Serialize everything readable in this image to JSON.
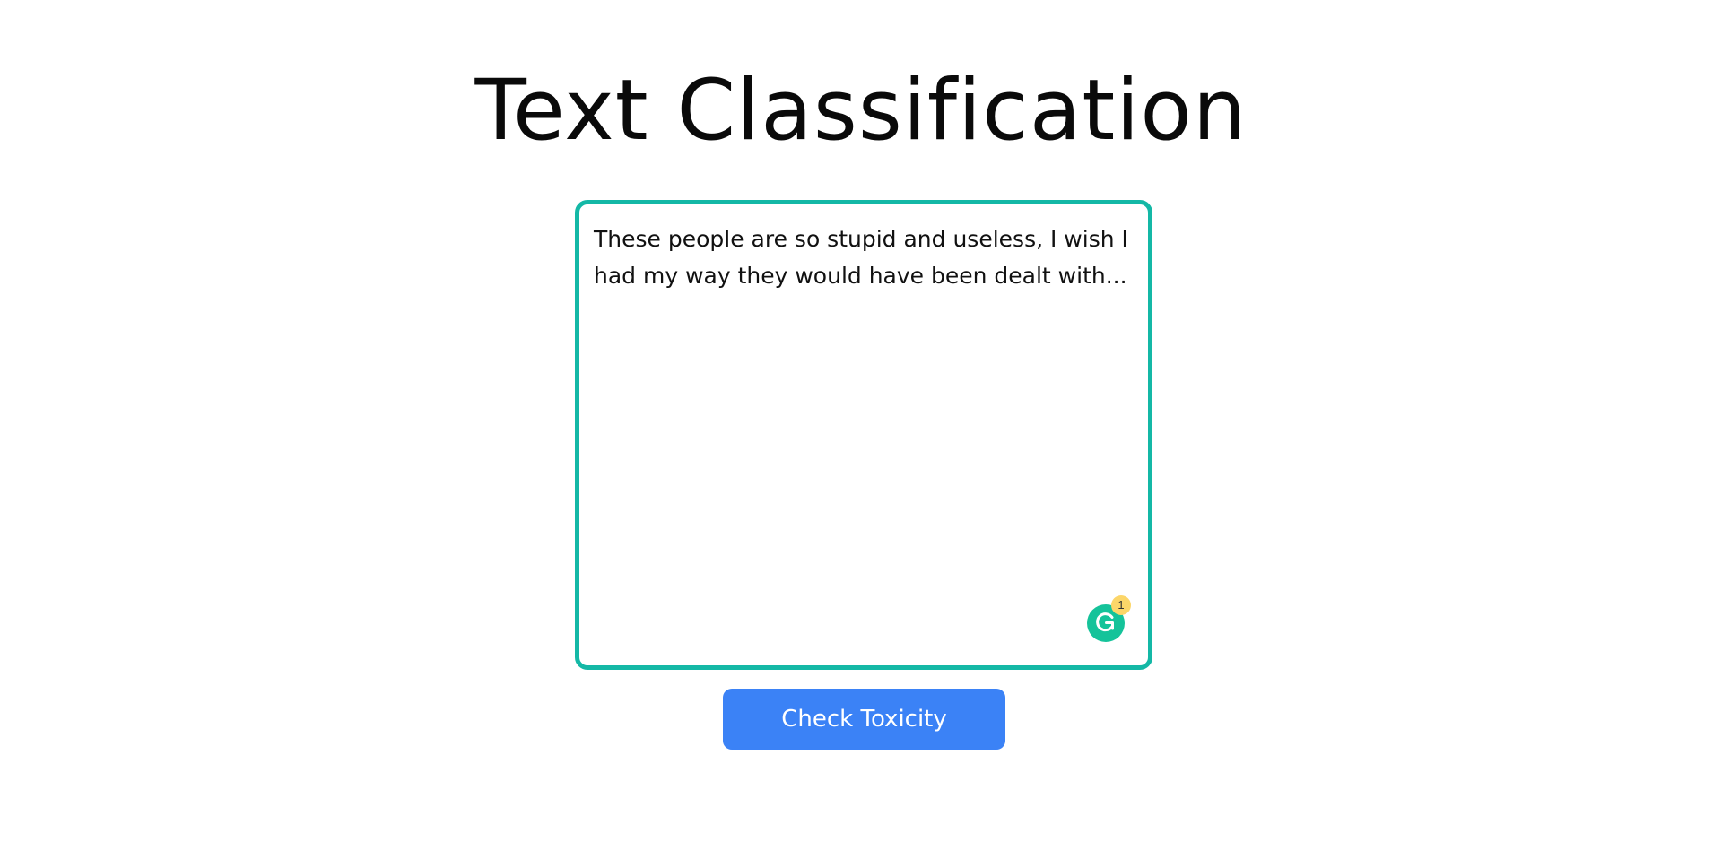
{
  "page": {
    "title": "Text Classification"
  },
  "input": {
    "value": "These people are so stupid and useless, I wish I had my way they would have been dealt with...",
    "border_color": "#14b8a6"
  },
  "grammarly": {
    "icon": "grammarly-icon",
    "badge_count": "1",
    "color": "#15c39a",
    "badge_color": "#fcd669"
  },
  "actions": {
    "check_label": "Check Toxicity",
    "button_color": "#3b82f6"
  }
}
